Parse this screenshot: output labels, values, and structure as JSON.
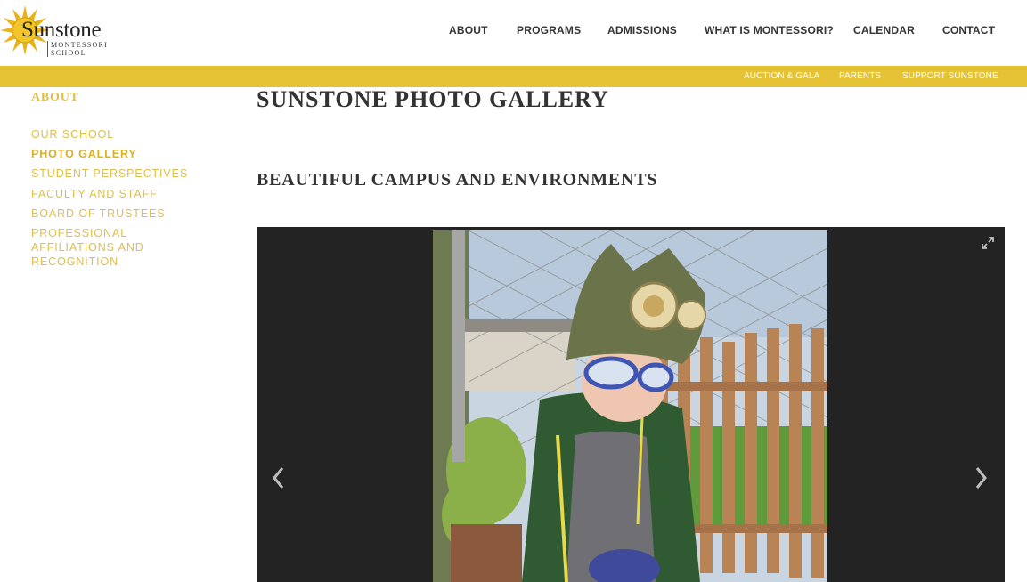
{
  "brand": {
    "name": "Sunstone",
    "sub_line1": "MONTESSORI",
    "sub_line2": "SCHOOL"
  },
  "main_nav": [
    "ABOUT",
    "PROGRAMS",
    "ADMISSIONS",
    "WHAT IS MONTESSORI?",
    "CALENDAR",
    "CONTACT"
  ],
  "sub_nav": [
    "AUCTION & GALA",
    "PARENTS",
    "SUPPORT SUNSTONE"
  ],
  "sidebar": {
    "heading": "ABOUT",
    "items": [
      {
        "label": "OUR SCHOOL"
      },
      {
        "label": "PHOTO GALLERY",
        "active": true
      },
      {
        "label": "STUDENT PERSPECTIVES"
      },
      {
        "label": "FACULTY AND STAFF"
      },
      {
        "label": "BOARD OF TRUSTEES"
      },
      {
        "label": "PROFESSIONAL AFFILIATIONS AND RECOGNITION"
      }
    ]
  },
  "page": {
    "title": "SUNSTONE PHOTO GALLERY",
    "section_title": "BEAUTIFUL CAMPUS AND ENVIRONMENTS"
  },
  "colors": {
    "accent_yellow": "#e5c334",
    "sidebar_text": "#e0be4a",
    "gallery_bg": "#232323"
  },
  "icons": {
    "prev": "chevron-left-icon",
    "next": "chevron-right-icon",
    "fullscreen": "expand-icon"
  }
}
